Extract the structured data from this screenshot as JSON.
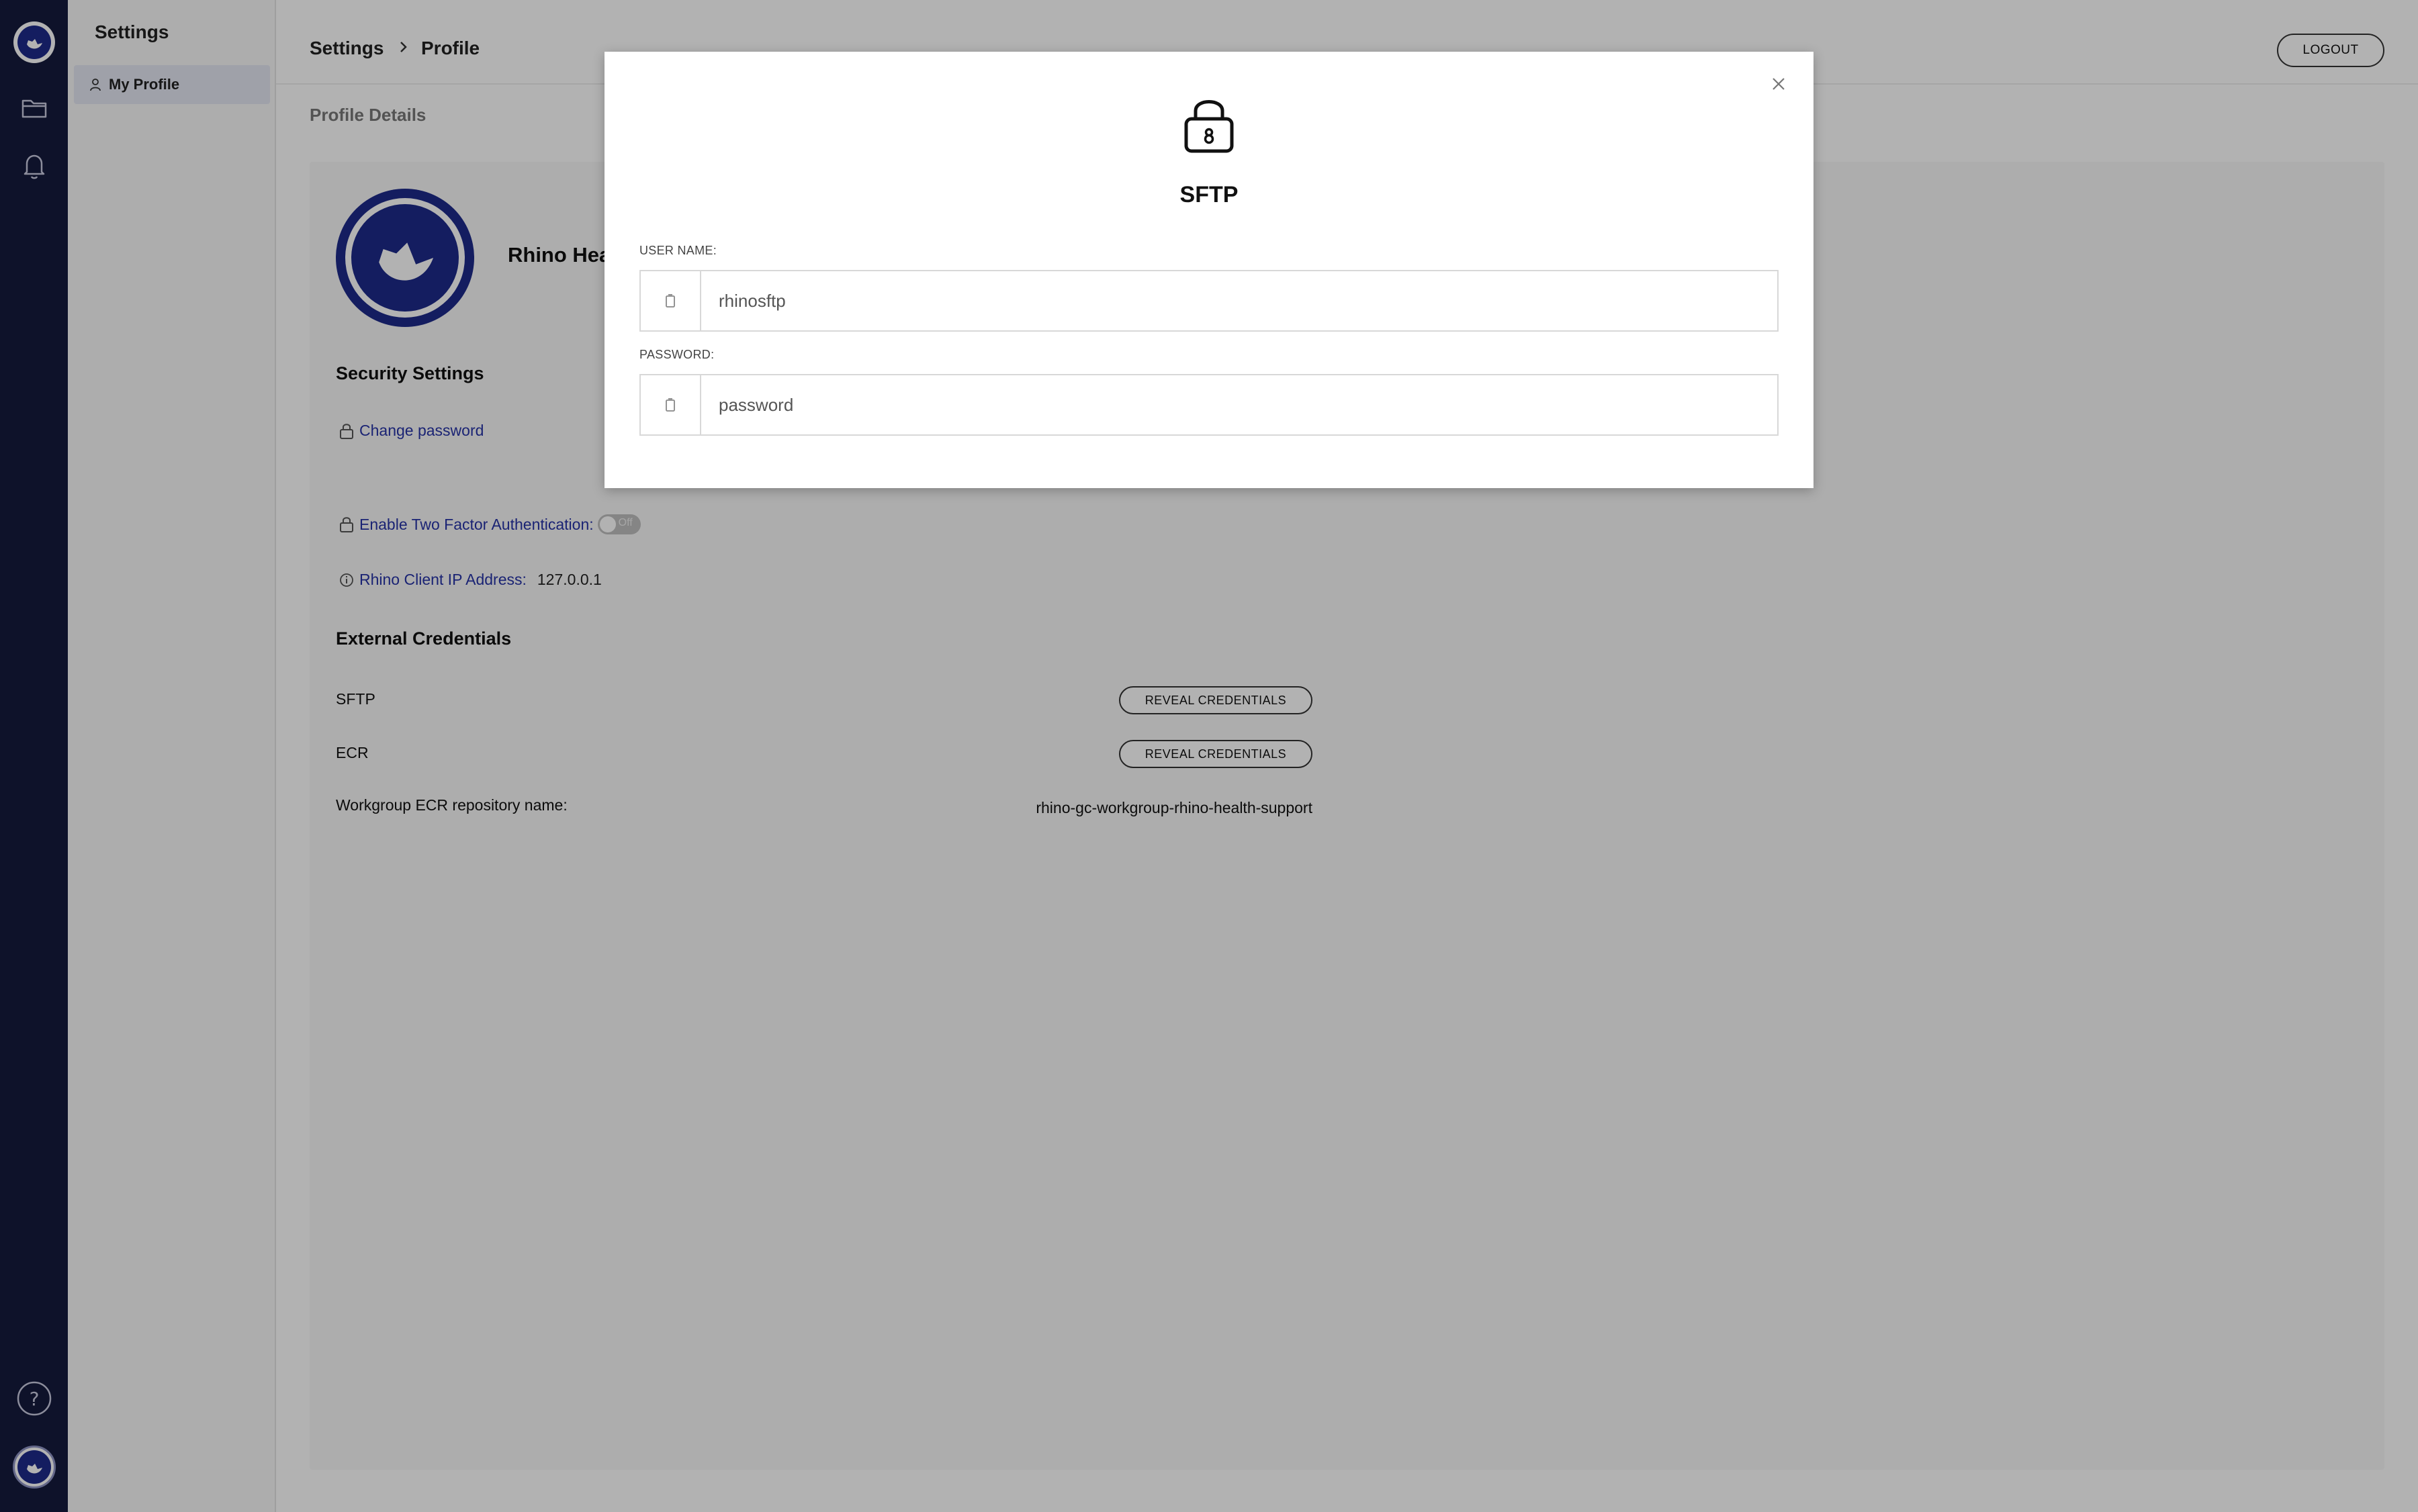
{
  "sidenav": {
    "title": "Settings",
    "items": [
      {
        "label": "My Profile"
      }
    ]
  },
  "header": {
    "breadcrumb": [
      "Settings",
      "Profile"
    ],
    "logout_label": "LOGOUT"
  },
  "profile": {
    "section_title": "Profile Details",
    "name_visible": "Rhino Heal",
    "security": {
      "title": "Security Settings",
      "change_password": "Change password",
      "two_factor_label": "Enable Two Factor Authentication:",
      "two_factor_state": "Off",
      "ip_label": "Rhino Client IP Address:",
      "ip_value": "127.0.0.1"
    },
    "external": {
      "title": "External Credentials",
      "rows": [
        {
          "label": "SFTP",
          "button": "REVEAL CREDENTIALS"
        },
        {
          "label": "ECR",
          "button": "REVEAL CREDENTIALS"
        }
      ],
      "repo_label": "Workgroup ECR repository name:",
      "repo_value": "rhino-gc-workgroup-rhino-health-support"
    }
  },
  "modal": {
    "title": "SFTP",
    "username_label": "USER NAME:",
    "username_value": "rhinosftp",
    "password_label": "PASSWORD:",
    "password_value": "password"
  },
  "colors": {
    "rail": "#151b3d",
    "brand_blue": "#1e2a8a",
    "link_blue": "#2633a6",
    "overlay": "rgba(0,0,0,0.30)"
  },
  "icons": {
    "rail": [
      "rhino-logo-icon",
      "folder-icon",
      "bell-icon",
      "help-icon",
      "user-avatar-icon"
    ],
    "modal": [
      "lock-icon",
      "close-icon",
      "copy-icon"
    ]
  }
}
